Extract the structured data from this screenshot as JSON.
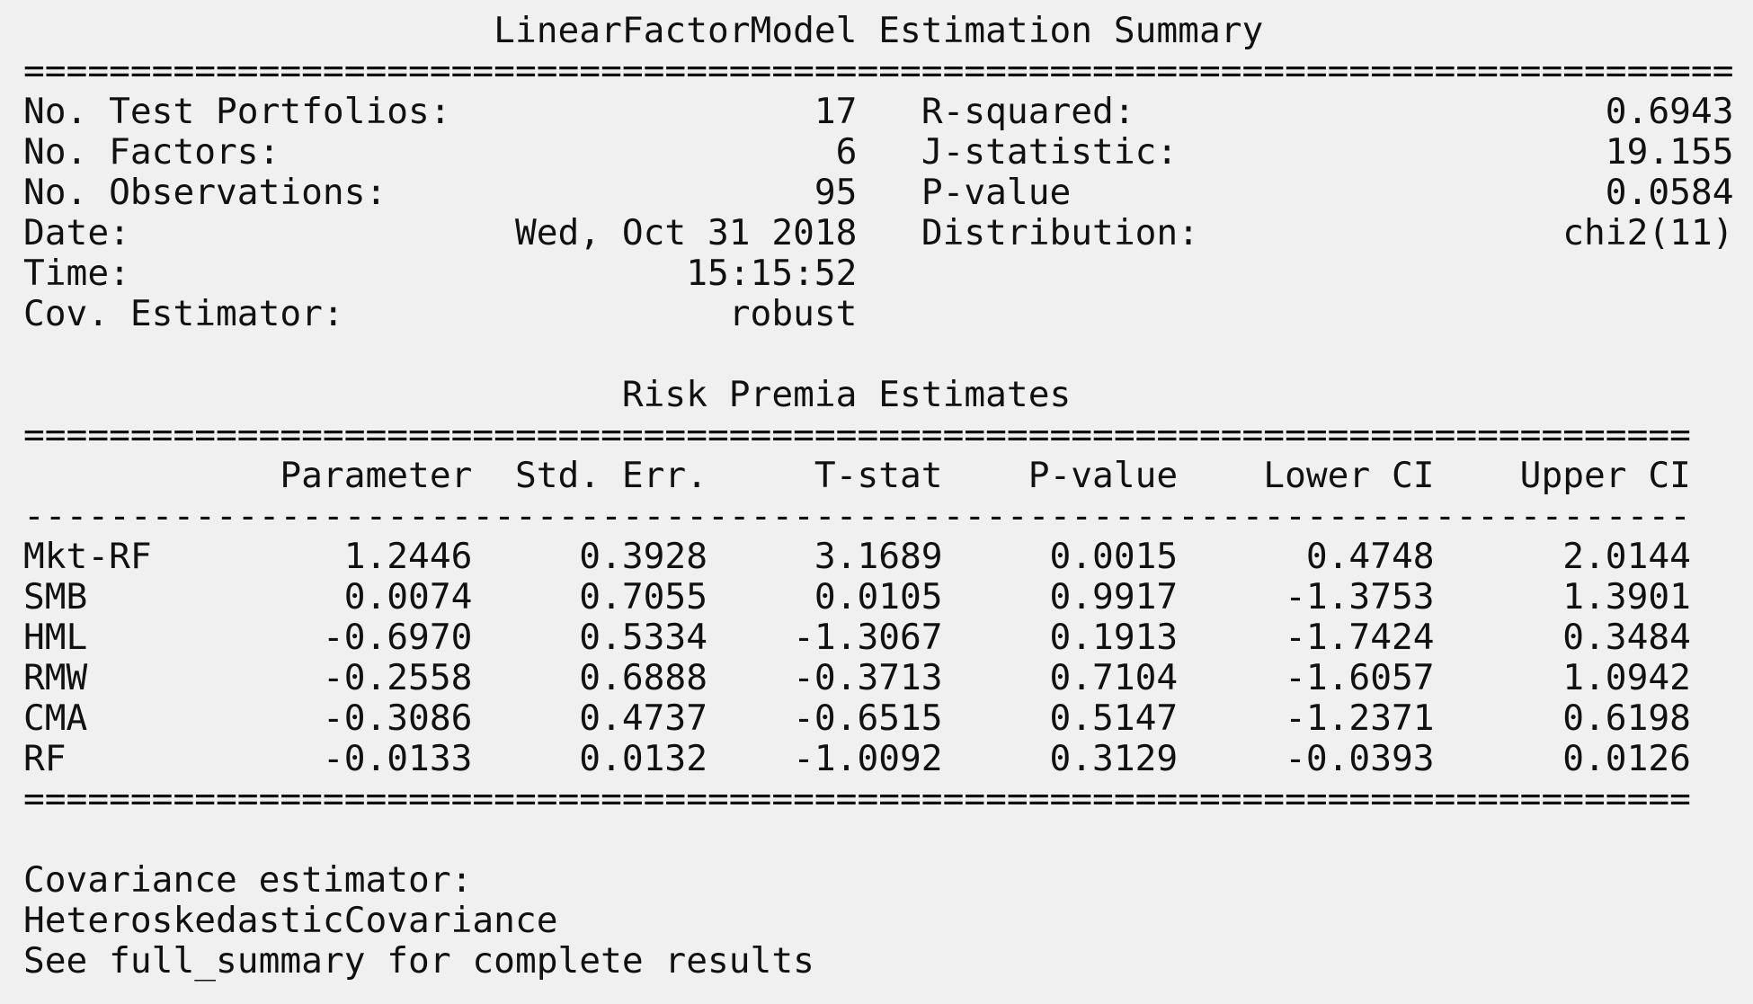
{
  "summary": {
    "title": "LinearFactorModel Estimation Summary",
    "left_stats": [
      {
        "label": "No. Test Portfolios:",
        "value": "17"
      },
      {
        "label": "No. Factors:",
        "value": "6"
      },
      {
        "label": "No. Observations:",
        "value": "95"
      },
      {
        "label": "Date:",
        "value": "Wed, Oct 31 2018"
      },
      {
        "label": "Time:",
        "value": "15:15:52"
      },
      {
        "label": "Cov. Estimator:",
        "value": "robust"
      }
    ],
    "right_stats": [
      {
        "label": "R-squared:",
        "value": "0.6943"
      },
      {
        "label": "J-statistic:",
        "value": "19.155"
      },
      {
        "label": "P-value",
        "value": "0.0584"
      },
      {
        "label": "Distribution:",
        "value": "chi2(11)"
      }
    ]
  },
  "risk_premia": {
    "title": "Risk Premia Estimates",
    "columns": [
      "Parameter",
      "Std. Err.",
      "T-stat",
      "P-value",
      "Lower CI",
      "Upper CI"
    ],
    "rows": [
      {
        "name": "Mkt-RF",
        "values": [
          "1.2446",
          "0.3928",
          "3.1689",
          "0.0015",
          "0.4748",
          "2.0144"
        ]
      },
      {
        "name": "SMB",
        "values": [
          "0.0074",
          "0.7055",
          "0.0105",
          "0.9917",
          "-1.3753",
          "1.3901"
        ]
      },
      {
        "name": "HML",
        "values": [
          "-0.6970",
          "0.5334",
          "-1.3067",
          "0.1913",
          "-1.7424",
          "0.3484"
        ]
      },
      {
        "name": "RMW",
        "values": [
          "-0.2558",
          "0.6888",
          "-0.3713",
          "0.7104",
          "-1.6057",
          "1.0942"
        ]
      },
      {
        "name": "CMA",
        "values": [
          "-0.3086",
          "0.4737",
          "-0.6515",
          "0.5147",
          "-1.2371",
          "0.6198"
        ]
      },
      {
        "name": "RF",
        "values": [
          "-0.0133",
          "0.0132",
          "-1.0092",
          "0.3129",
          "-0.0393",
          "0.0126"
        ]
      }
    ]
  },
  "notes": {
    "line1": "Covariance estimator:",
    "line2": "HeteroskedasticCovariance",
    "line3": "See full_summary for complete results"
  }
}
